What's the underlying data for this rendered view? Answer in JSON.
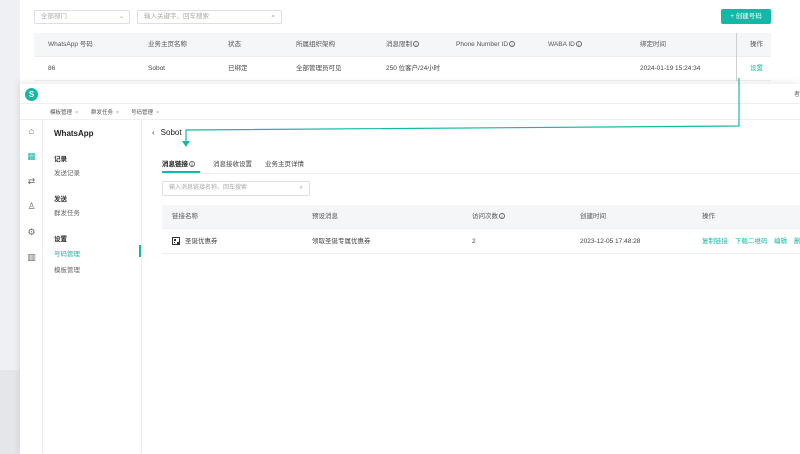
{
  "background": {
    "dept_select": "全部部门",
    "search_placeholder": "输入关键字、回车搜索",
    "create_button": "+ 创建号码",
    "columns": [
      "WhatsApp 号码",
      "业务主页名称",
      "状态",
      "所属组织架构",
      "消息限制",
      "Phone Number ID",
      "WABA ID",
      "绑定时间",
      "操作"
    ],
    "row": {
      "number": "86",
      "page_name": "Sobot",
      "status": "已绑定",
      "org": "全部管理员可见",
      "limit": "250 位客户/24小时",
      "phone_id": "",
      "waba_id": "",
      "bind_time": "2024-01-19 15:24:34",
      "action": "设置"
    }
  },
  "overlay": {
    "logo_letter": "S",
    "topbar_right": "者",
    "tabs": [
      "模板管理",
      "群发任务",
      "号码管理"
    ],
    "subnav": {
      "title": "WhatsApp",
      "group_record": "记录",
      "item_send_record": "发送记录",
      "group_send": "发送",
      "item_mass_task": "群发任务",
      "group_settings": "设置",
      "item_number_mgmt": "号码管理",
      "item_template_mgmt": "模板管理"
    },
    "back_title": "Sobot",
    "main_tabs": [
      "消息链接",
      "消息接收设置",
      "业务主页详情"
    ],
    "search_placeholder": "输入消息链接名称、回车搜索",
    "columns": [
      "链接名称",
      "预设消息",
      "访问次数",
      "创建时间",
      "操作"
    ],
    "row": {
      "name": "圣诞优惠券",
      "preset_message": "领取圣诞专属优惠券",
      "visits": "2",
      "created": "2023-12-05 17:48:28",
      "actions": [
        "复制链接",
        "下载二维码",
        "编辑",
        "删"
      ]
    }
  }
}
